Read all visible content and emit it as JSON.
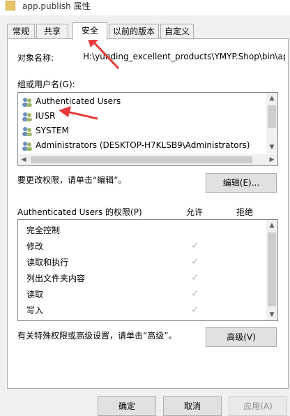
{
  "window": {
    "title": "app.publish 属性"
  },
  "tabs": [
    {
      "label": "常规"
    },
    {
      "label": "共享"
    },
    {
      "label": "安全"
    },
    {
      "label": "以前的版本"
    },
    {
      "label": "自定义"
    }
  ],
  "security": {
    "object_name_label": "对象名称:",
    "object_name_value": "H:\\yunding_excellent_products\\YMYP.Shop\\bin\\ap",
    "groups_label": "组或用户名(G):",
    "users": [
      {
        "name": "Authenticated Users"
      },
      {
        "name": "IUSR"
      },
      {
        "name": "SYSTEM"
      },
      {
        "name": "Administrators (DESKTOP-H7KLSB9\\Administrators)"
      }
    ],
    "change_hint": "要更改权限，请单击“编辑”。",
    "edit_button": "编辑(E)...",
    "perm_header": "Authenticated Users 的权限(P)",
    "allow_label": "允许",
    "deny_label": "拒绝",
    "permissions": [
      {
        "name": "完全控制",
        "allow": false
      },
      {
        "name": "修改",
        "allow": true
      },
      {
        "name": "读取和执行",
        "allow": true
      },
      {
        "name": "列出文件夹内容",
        "allow": true
      },
      {
        "name": "读取",
        "allow": true
      },
      {
        "name": "写入",
        "allow": true
      }
    ],
    "advanced_hint": "有关特殊权限或高级设置，请单击“高级”。",
    "advanced_button": "高级(V)"
  },
  "footer": {
    "ok": "确定",
    "cancel": "取消",
    "apply": "应用(A)"
  },
  "checkmark": "✓"
}
